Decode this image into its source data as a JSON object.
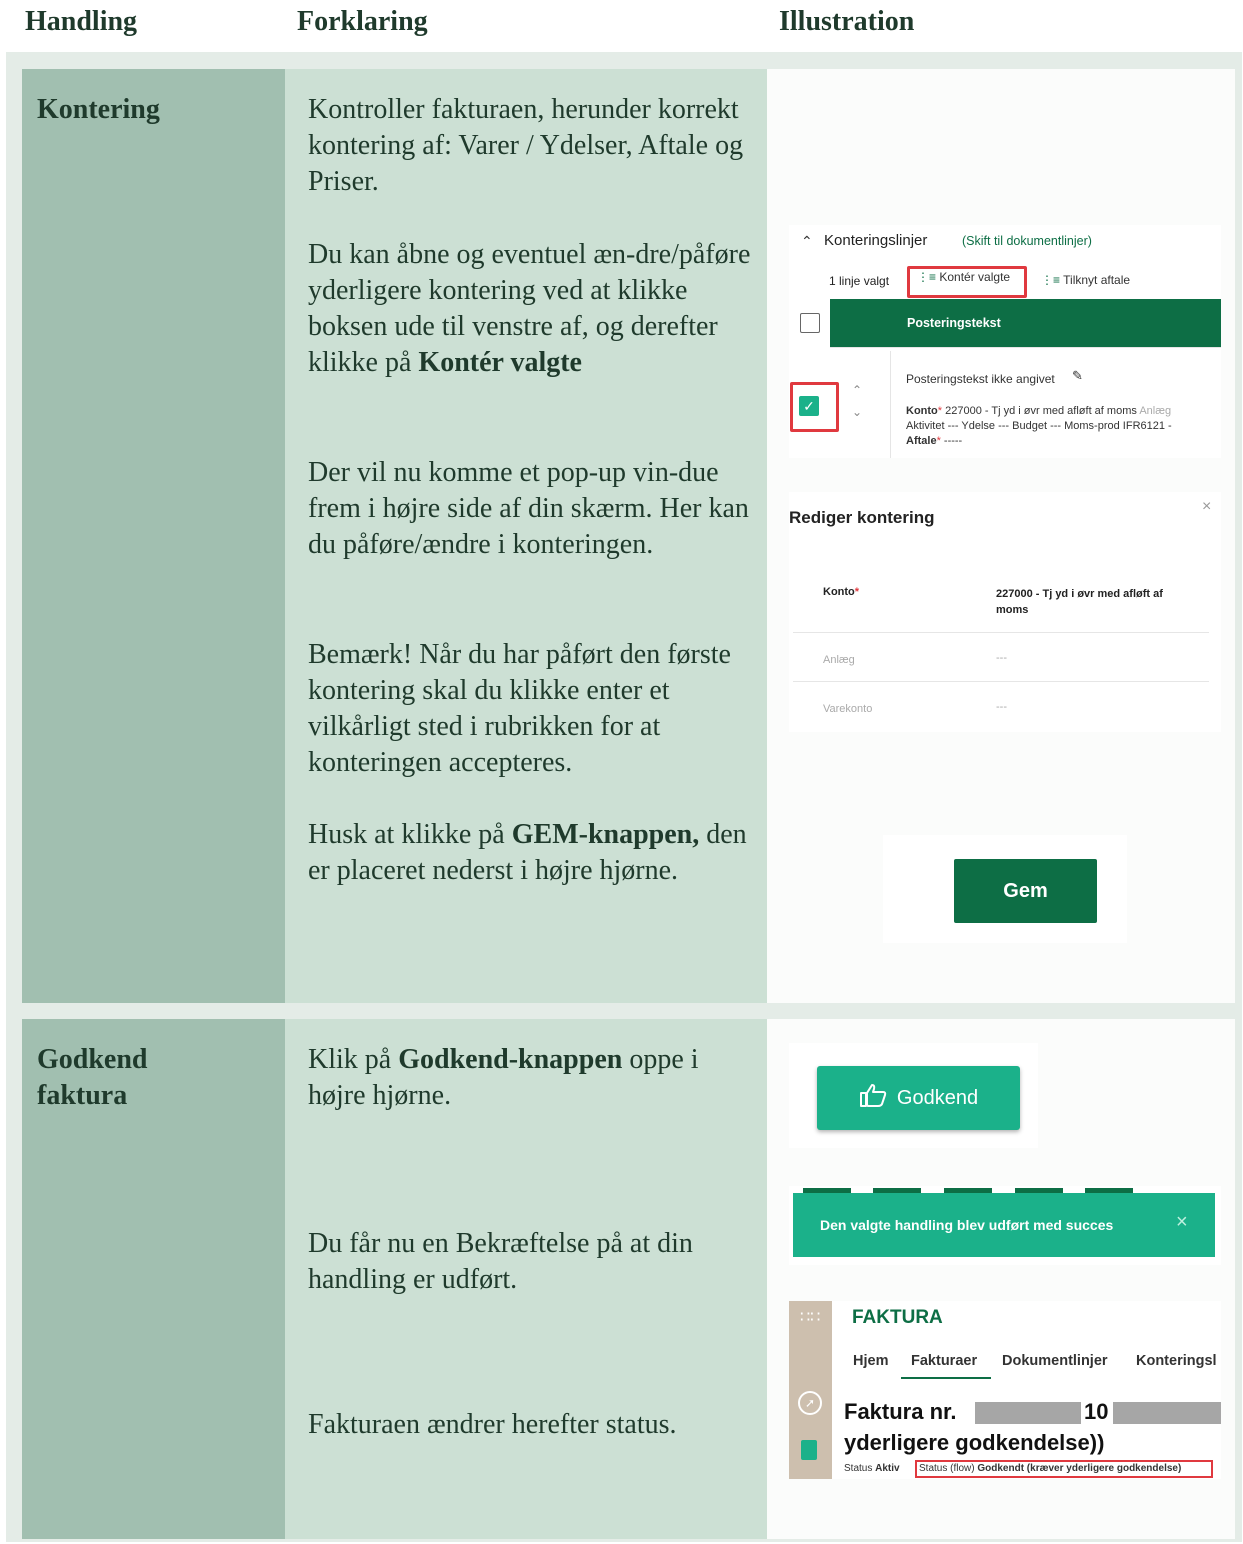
{
  "header": {
    "col1": "Handling",
    "col2": "Forklaring",
    "col3": "Illustration"
  },
  "row1": {
    "action": "Kontering",
    "p1": "Kontroller fakturaen, herunder korrekt kontering af: Varer / Ydelser, Aftale og Priser.",
    "p2_pre": "Du kan åbne og eventuel æn-dre/påføre yderligere kontering ved at klikke boksen ude til venstre af, og derefter klikke på ",
    "p2_bold": "Kontér valgte",
    "p3": "Der vil nu komme et pop-up vin-due frem i højre side af din skærm. Her kan du påføre/ændre i  konteringen.",
    "p4": "Bemærk! Når du har påført den første kontering skal du klikke enter et vilkårligt sted i rubrikken for at konteringen accepteres.",
    "p5_pre": "Husk at klikke på ",
    "p5_bold": "GEM-knappen,",
    "p5_post": " den er placeret nederst i højre hjørne."
  },
  "row2": {
    "action": "Godkend faktura",
    "p1_pre": "Klik på ",
    "p1_bold": "Godkend-knappen",
    "p1_post": " oppe i højre hjørne.",
    "p2": "Du får nu en Bekræftelse på at din handling er udført.",
    "p3": "Fakturaen ændrer herefter status."
  },
  "ill_kontering": {
    "section_title": "Konteringslinjer",
    "switch_link": "(Skift til dokumentlinjer)",
    "selected_count": "1 linje valgt",
    "konter_btn": "Kontér valgte",
    "tilknyt_btn": "Tilknyt aftale",
    "col_header": "Posteringstekst",
    "posting_text": "Posteringstekst ikke angivet",
    "konto_label": "Konto",
    "konto_value": "227000 - Tj yd i øvr med afløft af moms",
    "anlaeg_small": "Anlæg",
    "line2": "Aktivitet  ---  Ydelse  ---  Budget  ---  Moms-prod  IFR6121 -",
    "aftale_label": "Aftale",
    "aftale_value": "-----",
    "required_mark": "*"
  },
  "ill_rediger": {
    "title": "Rediger kontering",
    "close": "×",
    "konto_label": "Konto",
    "konto_value": "227000 - Tj yd i øvr med afløft af moms",
    "anlaeg_label": "Anlæg",
    "anlaeg_value": "---",
    "varekonto_label": "Varekonto",
    "varekonto_value": "---"
  },
  "ill_gem": {
    "button": "Gem"
  },
  "ill_godkend": {
    "button": "Godkend"
  },
  "ill_toast": {
    "message": "Den valgte handling blev udført med succes",
    "close": "×"
  },
  "ill_faktura": {
    "app_title": "FAKTURA",
    "tabs": [
      "Hjem",
      "Fakturaer",
      "Dokumentlinjer",
      "Konteringsl"
    ],
    "title_prefix": "Faktura nr.",
    "title_mid": "10",
    "title_line2": "yderligere godkendelse))",
    "status_label": "Status",
    "status_value": "Aktiv",
    "flow_label": "Status (flow)",
    "flow_value": "Godkendt (kræver yderligere godkendelse)"
  },
  "colors": {
    "action_col": "#a1bfb0",
    "text_col": "#cce0d4",
    "brand_green": "#0d6e45",
    "accent_green": "#1bb18a",
    "highlight_red": "#e0393f"
  }
}
